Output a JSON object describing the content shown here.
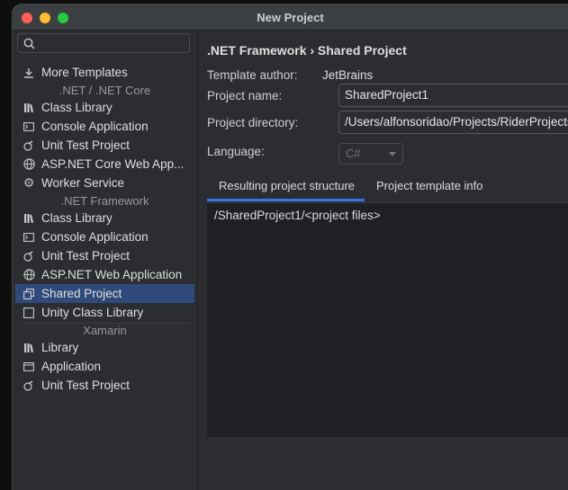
{
  "window": {
    "title": "New Project"
  },
  "search": {
    "placeholder": "",
    "value": ""
  },
  "sidebar": {
    "more_templates": "More Templates",
    "groups": {
      "net_core": ".NET / .NET Core",
      "net_framework": ".NET Framework",
      "xamarin": "Xamarin"
    },
    "core_items": [
      "Class Library",
      "Console Application",
      "Unit Test Project",
      "ASP.NET Core Web App...",
      "Worker Service"
    ],
    "framework_items": [
      "Class Library",
      "Console Application",
      "Unit Test Project",
      "ASP.NET Web Application",
      "Shared Project",
      "Unity Class Library"
    ],
    "xamarin_items": [
      "Library",
      "Application",
      "Unit Test Project"
    ],
    "selected": "Shared Project"
  },
  "main": {
    "breadcrumb": ".NET Framework › Shared Project",
    "template_author_label": "Template author:",
    "template_author": "JetBrains",
    "project_name_label": "Project name:",
    "project_name": "SharedProject1",
    "project_directory_label": "Project directory:",
    "project_directory": "/Users/alfonsoridao/Projects/RiderProjects",
    "language_label": "Language:",
    "language": "C#",
    "tabs": [
      "Resulting project structure",
      "Project template info"
    ],
    "structure_path": "/SharedProject1/<project files>"
  },
  "colors": {
    "accent": "#3574f0",
    "selection": "#2f4a7a",
    "background": "#2b2d30"
  }
}
